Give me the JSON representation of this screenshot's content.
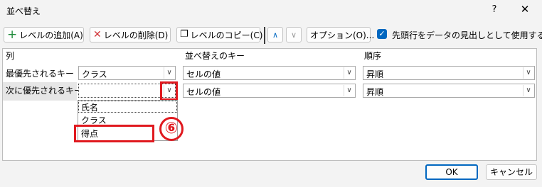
{
  "window": {
    "title": "並べ替え",
    "help_glyph": "?",
    "close_glyph": "✕"
  },
  "toolbar": {
    "add_level": "レベルの追加(A)",
    "delete_level": "レベルの削除(D)",
    "copy_level": "レベルのコピー(C)",
    "move_up_glyph": "∧",
    "move_down_glyph": "∨",
    "options": "オプション(O)...",
    "header_checkbox_label": "先頭行をデータの見出しとして使用する(H)",
    "header_checkbox_checked": true,
    "icons": [
      "plus-icon",
      "delete-x-icon",
      "copy-icon",
      "chevron-up-icon",
      "chevron-down-icon",
      "checkmark-icon"
    ]
  },
  "columns": {
    "col": "列",
    "sort_on": "並べ替えのキー",
    "order": "順序"
  },
  "rows": [
    {
      "label": "最優先されるキー",
      "column_value": "クラス",
      "sort_on_value": "セルの値",
      "order_value": "昇順"
    },
    {
      "label": "次に優先されるキー",
      "column_value": "",
      "sort_on_value": "セルの値",
      "order_value": "昇順"
    }
  ],
  "dropdown_options": [
    "氏名",
    "クラス",
    "得点"
  ],
  "annotation": {
    "step_number": "⑥"
  },
  "footer": {
    "ok": "OK",
    "cancel": "キャンセル"
  },
  "colors": {
    "accent": "#0067c0",
    "highlight_red": "#e0191f",
    "add_icon_green": "#1f8a3a",
    "delete_icon_red": "#d13438"
  }
}
